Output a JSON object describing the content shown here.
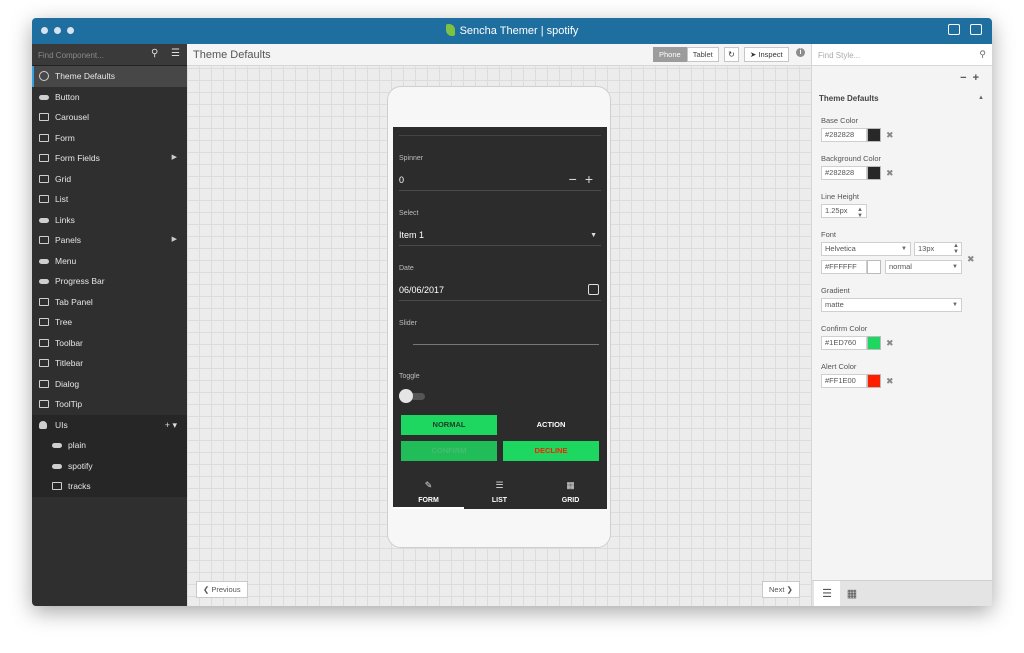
{
  "window": {
    "title": "Sencha Themer | spotify"
  },
  "sidebar": {
    "search_placeholder": "Find Component...",
    "items": [
      {
        "label": "Theme Defaults",
        "icon": "globe-icon"
      },
      {
        "label": "Button",
        "icon": "button-icon"
      },
      {
        "label": "Carousel",
        "icon": "carousel-icon"
      },
      {
        "label": "Form",
        "icon": "form-icon"
      },
      {
        "label": "Form Fields",
        "icon": "form-fields-icon"
      },
      {
        "label": "Grid",
        "icon": "grid-icon"
      },
      {
        "label": "List",
        "icon": "list-icon"
      },
      {
        "label": "Links",
        "icon": "links-icon"
      },
      {
        "label": "Panels",
        "icon": "panels-icon"
      },
      {
        "label": "Menu",
        "icon": "menu-icon"
      },
      {
        "label": "Progress Bar",
        "icon": "progress-bar-icon"
      },
      {
        "label": "Tab Panel",
        "icon": "tab-panel-icon"
      },
      {
        "label": "Tree",
        "icon": "tree-icon"
      },
      {
        "label": "Toolbar",
        "icon": "toolbar-icon"
      },
      {
        "label": "Titlebar",
        "icon": "titlebar-icon"
      },
      {
        "label": "Dialog",
        "icon": "dialog-icon"
      },
      {
        "label": "ToolTip",
        "icon": "tooltip-icon"
      }
    ],
    "uis": {
      "label": "UIs",
      "children": [
        {
          "label": "plain"
        },
        {
          "label": "spotify"
        },
        {
          "label": "tracks"
        }
      ]
    }
  },
  "center": {
    "title": "Theme Defaults",
    "phone_label": "Phone",
    "tablet_label": "Tablet",
    "inspect_label": "Inspect",
    "previous_label": "Previous",
    "next_label": "Next"
  },
  "preview": {
    "spinner": {
      "label": "Spinner",
      "value": "0"
    },
    "select": {
      "label": "Select",
      "value": "Item 1"
    },
    "date": {
      "label": "Date",
      "value": "06/06/2017"
    },
    "slider": {
      "label": "Slider"
    },
    "toggle": {
      "label": "Toggle"
    },
    "buttons": {
      "normal": "NORMAL",
      "action": "ACTION",
      "confirm": "CONFIRM",
      "decline": "DECLINE"
    },
    "tabs": [
      {
        "label": "FORM",
        "icon": "edit-icon"
      },
      {
        "label": "LIST",
        "icon": "list-icon"
      },
      {
        "label": "GRID",
        "icon": "grid-icon"
      }
    ]
  },
  "panel": {
    "search_placeholder": "Find Style...",
    "section_title": "Theme Defaults",
    "base_color": {
      "label": "Base Color",
      "value": "#282828"
    },
    "background_color": {
      "label": "Background Color",
      "value": "#282828"
    },
    "line_height": {
      "label": "Line Height",
      "value": "1.25px"
    },
    "font": {
      "label": "Font",
      "family": "Helvetica",
      "size": "13px",
      "color": "#FFFFFF",
      "weight": "normal"
    },
    "gradient": {
      "label": "Gradient",
      "value": "matte"
    },
    "confirm_color": {
      "label": "Confirm Color",
      "value": "#1ED760"
    },
    "alert_color": {
      "label": "Alert Color",
      "value": "#FF1E00"
    },
    "colors": {
      "swatch_base": "#282828",
      "swatch_bg": "#282828",
      "swatch_font": "#FFFFFF",
      "swatch_confirm": "#1ED760",
      "swatch_alert": "#FF1E00"
    }
  }
}
